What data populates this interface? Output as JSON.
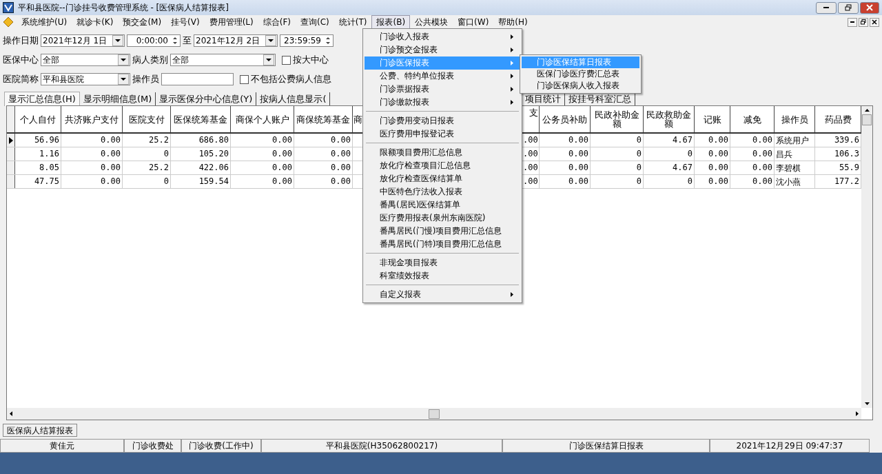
{
  "window": {
    "title": "平和县医院--门诊挂号收费管理系统 - [医保病人结算报表]"
  },
  "menu_bar": [
    {
      "label": "系统维护(U)",
      "selected": false
    },
    {
      "label": "就诊卡(K)",
      "selected": false
    },
    {
      "label": "预交金(M)",
      "selected": false
    },
    {
      "label": "挂号(V)",
      "selected": false
    },
    {
      "label": "费用管理(L)",
      "selected": false
    },
    {
      "label": "综合(F)",
      "selected": false
    },
    {
      "label": "查询(C)",
      "selected": false
    },
    {
      "label": "统计(T)",
      "selected": false
    },
    {
      "label": "报表(B)",
      "selected": true
    },
    {
      "label": "公共模块",
      "selected": false
    },
    {
      "label": "窗口(W)",
      "selected": false
    },
    {
      "label": "帮助(H)",
      "selected": false
    }
  ],
  "filters": {
    "date_label": "操作日期",
    "date_from": "2021年12月 1日",
    "time_from": "0:00:00",
    "to_label": "至",
    "date_to": "2021年12月 2日",
    "time_to": "23:59:59",
    "center_label": "医保中心",
    "center": "全部",
    "patient_type_label": "病人类别",
    "patient_type": "全部",
    "by_big_center": {
      "label": "按大中心",
      "checked": false
    },
    "hospital_label": "医院简称",
    "hospital": "平和县医院",
    "operator_label": "操作员",
    "exclude_public": {
      "label": "不包括公费病人信息",
      "checked": false
    }
  },
  "tabs": [
    {
      "label": "显示汇总信息(H)",
      "selected": true
    },
    {
      "label": "显示明细信息(M)",
      "selected": false
    },
    {
      "label": "显示医保分中心信息(Y)",
      "selected": false
    },
    {
      "label": "按病人信息显示(",
      "selected": false
    },
    {
      "label": "项目统计",
      "selected": false
    },
    {
      "label": "按挂号科室汇总",
      "selected": false
    }
  ],
  "table": {
    "columns": [
      "个人自付",
      "共济账户支付",
      "医院支付",
      "医保统筹基金",
      "商保个人账户",
      "商保统筹基金",
      "商",
      "支",
      "公务员补助",
      "民政补助金额",
      "民政救助金额",
      "记账",
      "减免",
      "操作员",
      "药品费"
    ],
    "rows": [
      {
        "current": true,
        "cells": [
          "56.96",
          "0.00",
          "25.2",
          "686.80",
          "0.00",
          "0.00",
          null,
          ".00",
          "0.00",
          "0",
          "4.67",
          "0.00",
          "0.00",
          "系统用户",
          "339.6"
        ]
      },
      {
        "current": false,
        "cells": [
          "1.16",
          "0.00",
          "0",
          "105.20",
          "0.00",
          "0.00",
          null,
          ".00",
          "0.00",
          "0",
          "0",
          "0.00",
          "0.00",
          "昌兵",
          "106.3"
        ]
      },
      {
        "current": false,
        "cells": [
          "8.05",
          "0.00",
          "25.2",
          "422.06",
          "0.00",
          "0.00",
          null,
          ".00",
          "0.00",
          "0",
          "4.67",
          "0.00",
          "0.00",
          "李碧棋",
          "55.9"
        ]
      },
      {
        "current": false,
        "cells": [
          "47.75",
          "0.00",
          "0",
          "159.54",
          "0.00",
          "0.00",
          null,
          ".00",
          "0.00",
          "0",
          "0",
          "0.00",
          "0.00",
          "沈小燕",
          "177.2"
        ]
      }
    ]
  },
  "report_menu": [
    {
      "kind": "item",
      "label": "门诊收入报表",
      "submenu": true,
      "selected": false
    },
    {
      "kind": "item",
      "label": "门诊预交金报表",
      "submenu": true,
      "selected": false
    },
    {
      "kind": "item",
      "label": "门诊医保报表",
      "submenu": true,
      "selected": true
    },
    {
      "kind": "item",
      "label": "公费、特约单位报表",
      "submenu": true,
      "selected": false
    },
    {
      "kind": "item",
      "label": "门诊票据报表",
      "submenu": true,
      "selected": false
    },
    {
      "kind": "item",
      "label": "门诊缴款报表",
      "submenu": true,
      "selected": false
    },
    {
      "kind": "separator"
    },
    {
      "kind": "item",
      "label": "门诊费用变动日报表",
      "submenu": false,
      "selected": false
    },
    {
      "kind": "item",
      "label": "医疗费用申报登记表",
      "submenu": false,
      "selected": false
    },
    {
      "kind": "separator"
    },
    {
      "kind": "item",
      "label": "限额项目费用汇总信息",
      "submenu": false,
      "selected": false
    },
    {
      "kind": "item",
      "label": "放化疗检查项目汇总信息",
      "submenu": false,
      "selected": false
    },
    {
      "kind": "item",
      "label": "放化疗检查医保结算单",
      "submenu": false,
      "selected": false
    },
    {
      "kind": "item",
      "label": "中医特色疗法收入报表",
      "submenu": false,
      "selected": false
    },
    {
      "kind": "item",
      "label": "番禺(居民)医保结算单",
      "submenu": false,
      "selected": false
    },
    {
      "kind": "item",
      "label": "医疗费用报表(泉州东南医院)",
      "submenu": false,
      "selected": false
    },
    {
      "kind": "item",
      "label": "番禺居民(门慢)项目费用汇总信息",
      "submenu": false,
      "selected": false
    },
    {
      "kind": "item",
      "label": "番禺居民(门特)项目费用汇总信息",
      "submenu": false,
      "selected": false
    },
    {
      "kind": "separator"
    },
    {
      "kind": "item",
      "label": "非现金项目报表",
      "submenu": false,
      "selected": false
    },
    {
      "kind": "item",
      "label": "科室绩效报表",
      "submenu": false,
      "selected": false
    },
    {
      "kind": "separator"
    },
    {
      "kind": "item",
      "label": "自定义报表",
      "submenu": true,
      "selected": false
    }
  ],
  "submenu": [
    {
      "label": "门诊医保结算日报表",
      "selected": true
    },
    {
      "label": "医保门诊医疗费汇总表",
      "selected": false
    },
    {
      "label": "门诊医保病人收入报表",
      "selected": false
    }
  ],
  "window_tabs": [
    "医保病人结算报表"
  ],
  "status_bar": [
    "黄佳元",
    "门诊收费处",
    "门诊收费(工作中)",
    "平和县医院(H35062800217)",
    "门诊医保结算日报表",
    "2021年12月29日 09:47:37"
  ]
}
